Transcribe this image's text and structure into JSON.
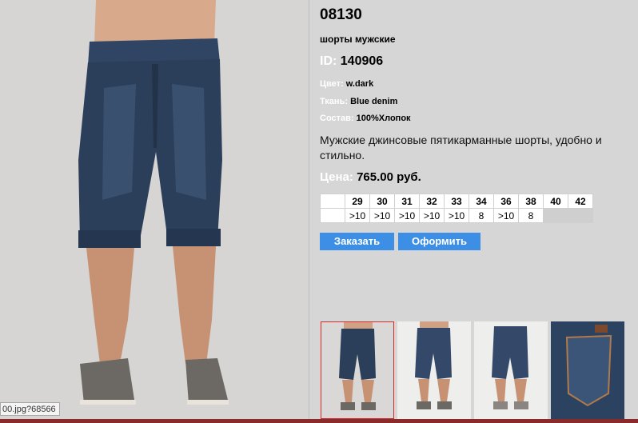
{
  "product": {
    "article": "08130",
    "subtitle": "шорты мужские",
    "id_label": "ID:",
    "id_value": "140906",
    "color_label": "Цвет:",
    "color_value": "w.dark",
    "fabric_label": "Ткань:",
    "fabric_value": "Blue denim",
    "composition_label": "Состав:",
    "composition_value": "100%Хлопок",
    "description": "Мужские джинсовые пятикарманные шорты, удобно и стильно.",
    "price_label": "Цена:",
    "price_value": "765.00 руб."
  },
  "sizes": {
    "headers": [
      "29",
      "30",
      "31",
      "32",
      "33",
      "34",
      "36",
      "38",
      "40",
      "42"
    ],
    "stock": [
      ">10",
      ">10",
      ">10",
      ">10",
      ">10",
      "8",
      ">10",
      "8",
      "",
      ""
    ]
  },
  "buttons": {
    "order": "Заказать",
    "checkout": "Оформить"
  },
  "status_url": "00.jpg?68566",
  "colors": {
    "background": "#d6d6d6",
    "accent_button": "#3d8fe6",
    "thumb_active_border": "#d42b2b",
    "denim": "#2c3f5a",
    "label_white": "#ffffff"
  },
  "thumbnails": [
    "front-dark-view",
    "front-light-view",
    "back-view",
    "pocket-detail"
  ]
}
